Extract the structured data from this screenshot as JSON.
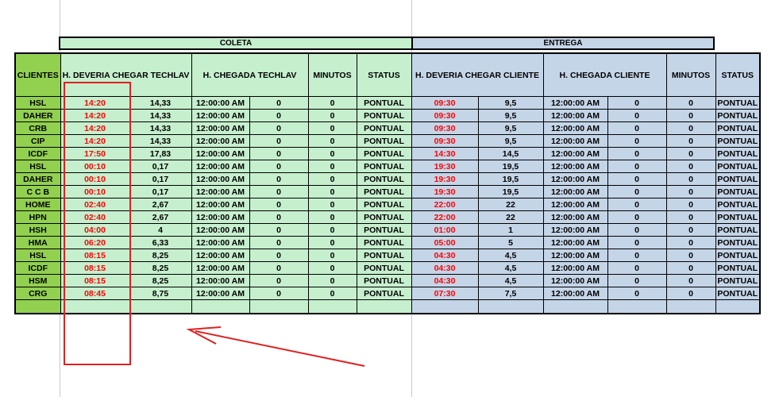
{
  "groups": {
    "coleta": "COLETA",
    "entrega": "ENTREGA"
  },
  "headers": [
    "CLIENTES",
    "H. DEVERIA CHEGAR TECHLAV",
    "H. CHEGADA TECHLAV",
    "MINUTOS",
    "STATUS",
    "H. DEVERIA CHEGAR CLIENTE",
    "H. CHEGADA CLIENTE",
    "MINUTOS",
    "STATUS"
  ],
  "rows": [
    [
      "HSL",
      "14:20",
      "14,33",
      "12:00:00 AM",
      "0",
      "0",
      "PONTUAL",
      "09:30",
      "9,5",
      "12:00:00 AM",
      "0",
      "0",
      "PONTUAL"
    ],
    [
      "DAHER",
      "14:20",
      "14,33",
      "12:00:00 AM",
      "0",
      "0",
      "PONTUAL",
      "09:30",
      "9,5",
      "12:00:00 AM",
      "0",
      "0",
      "PONTUAL"
    ],
    [
      "CRB",
      "14:20",
      "14,33",
      "12:00:00 AM",
      "0",
      "0",
      "PONTUAL",
      "09:30",
      "9,5",
      "12:00:00 AM",
      "0",
      "0",
      "PONTUAL"
    ],
    [
      "CIP",
      "14:20",
      "14,33",
      "12:00:00 AM",
      "0",
      "0",
      "PONTUAL",
      "09:30",
      "9,5",
      "12:00:00 AM",
      "0",
      "0",
      "PONTUAL"
    ],
    [
      "ICDF",
      "17:50",
      "17,83",
      "12:00:00 AM",
      "0",
      "0",
      "PONTUAL",
      "14:30",
      "14,5",
      "12:00:00 AM",
      "0",
      "0",
      "PONTUAL"
    ],
    [
      "HSL",
      "00:10",
      "0,17",
      "12:00:00 AM",
      "0",
      "0",
      "PONTUAL",
      "19:30",
      "19,5",
      "12:00:00 AM",
      "0",
      "0",
      "PONTUAL"
    ],
    [
      "DAHER",
      "00:10",
      "0,17",
      "12:00:00 AM",
      "0",
      "0",
      "PONTUAL",
      "19:30",
      "19,5",
      "12:00:00 AM",
      "0",
      "0",
      "PONTUAL"
    ],
    [
      "C C B",
      "00:10",
      "0,17",
      "12:00:00 AM",
      "0",
      "0",
      "PONTUAL",
      "19:30",
      "19,5",
      "12:00:00 AM",
      "0",
      "0",
      "PONTUAL"
    ],
    [
      "HOME",
      "02:40",
      "2,67",
      "12:00:00 AM",
      "0",
      "0",
      "PONTUAL",
      "22:00",
      "22",
      "12:00:00 AM",
      "0",
      "0",
      "PONTUAL"
    ],
    [
      "HPN",
      "02:40",
      "2,67",
      "12:00:00 AM",
      "0",
      "0",
      "PONTUAL",
      "22:00",
      "22",
      "12:00:00 AM",
      "0",
      "0",
      "PONTUAL"
    ],
    [
      "HSH",
      "04:00",
      "4",
      "12:00:00 AM",
      "0",
      "0",
      "PONTUAL",
      "01:00",
      "1",
      "12:00:00 AM",
      "0",
      "0",
      "PONTUAL"
    ],
    [
      "HMA",
      "06:20",
      "6,33",
      "12:00:00 AM",
      "0",
      "0",
      "PONTUAL",
      "05:00",
      "5",
      "12:00:00 AM",
      "0",
      "0",
      "PONTUAL"
    ],
    [
      "HSL",
      "08:15",
      "8,25",
      "12:00:00 AM",
      "0",
      "0",
      "PONTUAL",
      "04:30",
      "4,5",
      "12:00:00 AM",
      "0",
      "0",
      "PONTUAL"
    ],
    [
      "ICDF",
      "08:15",
      "8,25",
      "12:00:00 AM",
      "0",
      "0",
      "PONTUAL",
      "04:30",
      "4,5",
      "12:00:00 AM",
      "0",
      "0",
      "PONTUAL"
    ],
    [
      "HSM",
      "08:15",
      "8,25",
      "12:00:00 AM",
      "0",
      "0",
      "PONTUAL",
      "04:30",
      "4,5",
      "12:00:00 AM",
      "0",
      "0",
      "PONTUAL"
    ],
    [
      "CRG",
      "08:45",
      "8,75",
      "12:00:00 AM",
      "0",
      "0",
      "PONTUAL",
      "07:30",
      "7,5",
      "12:00:00 AM",
      "0",
      "0",
      "PONTUAL"
    ]
  ],
  "colors": {
    "clientes": "#92d050",
    "coleta": "#c6efce",
    "entrega": "#c5d5e8",
    "highlight_text": "#ff0000",
    "annotation": "#e02020"
  }
}
